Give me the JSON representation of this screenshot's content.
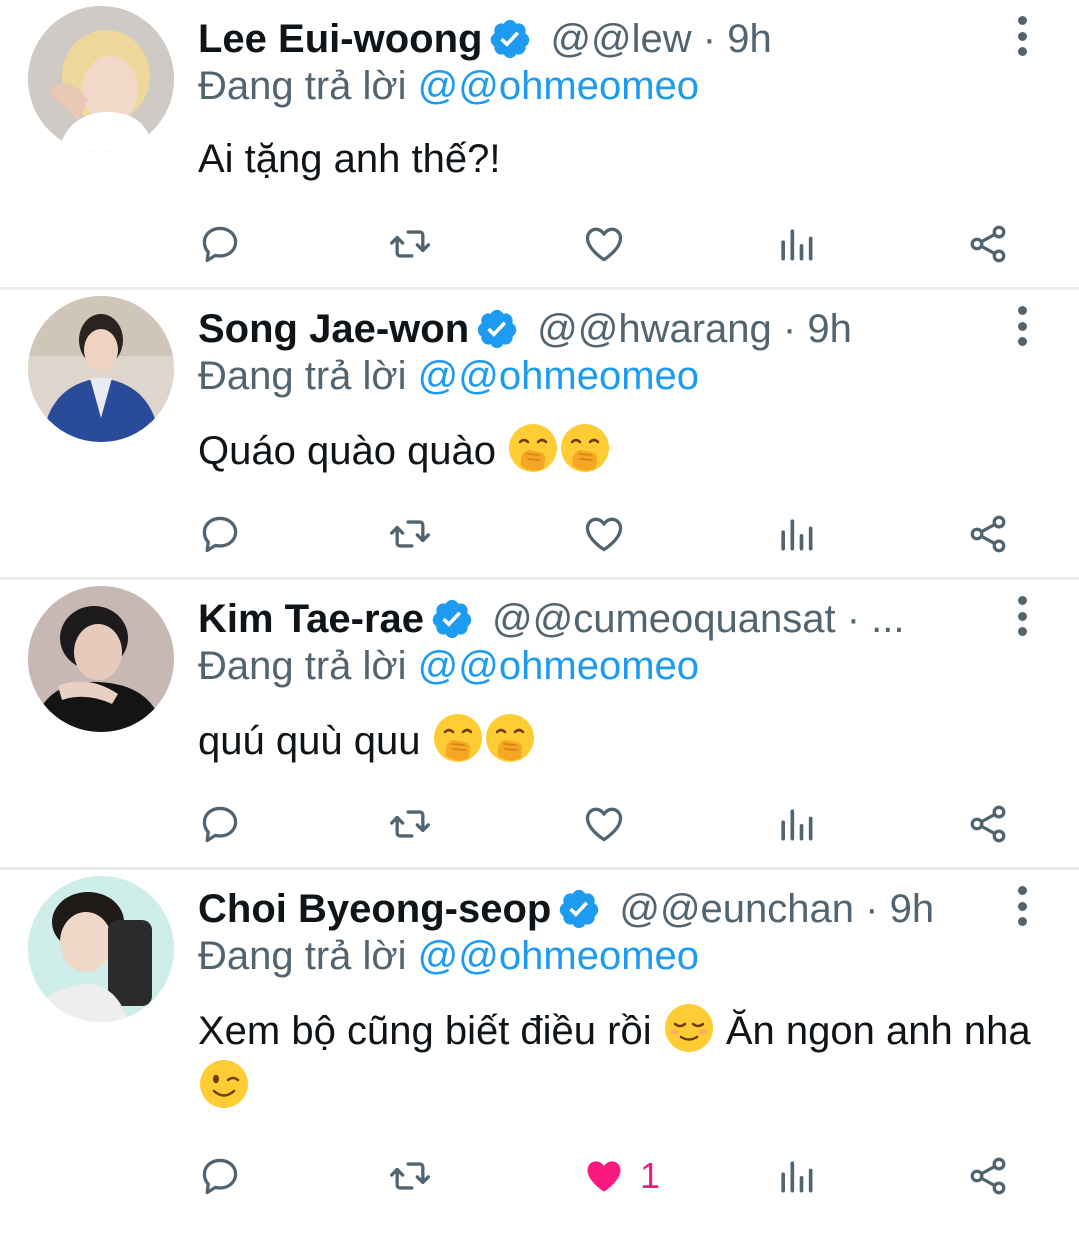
{
  "colors": {
    "accent": "#1d9bf0",
    "secondary_text": "#536471",
    "like_active": "#f91880",
    "divider": "#e6ecf0"
  },
  "tweets": [
    {
      "name": "Lee Eui-woong",
      "handle": "@@lew · 9h",
      "replying_label": "Đang trả lời",
      "replying_mention": "@@ohmeomeo",
      "text": "Ai tặng anh thế?!",
      "emojis": [],
      "like_count": "",
      "liked": false
    },
    {
      "name": "Song Jae-won",
      "handle": "@@hwarang · 9h",
      "replying_label": "Đang trả lời",
      "replying_mention": "@@ohmeomeo",
      "text": "Quáo quào quào",
      "emojis": [
        "hand-over-mouth",
        "hand-over-mouth"
      ],
      "like_count": "",
      "liked": false
    },
    {
      "name": "Kim Tae-rae",
      "handle": "@@cumeoquansat · ...",
      "replying_label": "Đang trả lời",
      "replying_mention": "@@ohmeomeo",
      "text": "quú quù quu",
      "emojis": [
        "hand-over-mouth",
        "hand-over-mouth"
      ],
      "like_count": "",
      "liked": false
    },
    {
      "name": "Choi Byeong-seop",
      "handle": "@@eunchan · 9h",
      "replying_label": "Đang trả lời",
      "replying_mention": "@@ohmeomeo",
      "text_part1": "Xem bộ cũng biết điều rồi",
      "text_part2": "Ăn ngon anh nha",
      "emojis": [
        "relieved-face",
        "winking-face"
      ],
      "like_count": "1",
      "liked": true
    }
  ],
  "icons": {
    "verified": "verified-badge-icon",
    "more": "more-vertical-icon",
    "reply": "reply-bubble-icon",
    "retweet": "retweet-icon",
    "like": "heart-icon",
    "stats": "analytics-bars-icon",
    "share": "share-icon"
  }
}
